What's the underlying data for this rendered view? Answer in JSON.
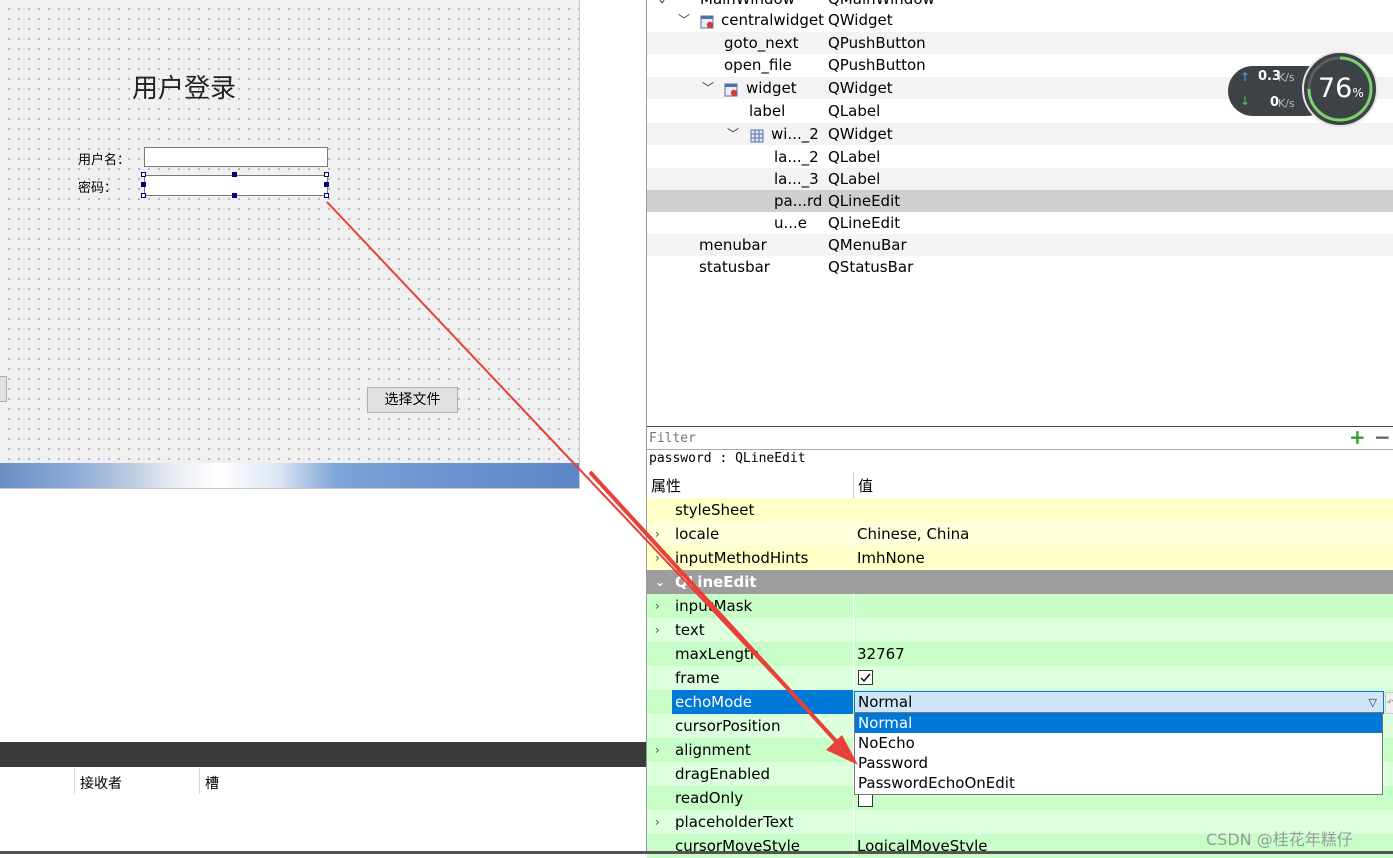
{
  "form": {
    "title": "用户登录",
    "username_label": "用户名：",
    "password_label": "密码：",
    "choose_file_button": "选择文件"
  },
  "bottom_table": {
    "headers": [
      "接收者",
      "槽"
    ]
  },
  "object_tree": {
    "rows": [
      {
        "name": "MainWindow",
        "class": "QMainWindow"
      },
      {
        "name": "centralwidget",
        "class": "QWidget"
      },
      {
        "name": "goto_next",
        "class": "QPushButton"
      },
      {
        "name": "open_file",
        "class": "QPushButton"
      },
      {
        "name": "widget",
        "class": "QWidget"
      },
      {
        "name": "label",
        "class": "QLabel"
      },
      {
        "name": "wi..._2",
        "class": "QWidget"
      },
      {
        "name": "la..._2",
        "class": "QLabel"
      },
      {
        "name": "la..._3",
        "class": "QLabel"
      },
      {
        "name": "pa...rd",
        "class": "QLineEdit"
      },
      {
        "name": "u...e",
        "class": "QLineEdit"
      },
      {
        "name": "menubar",
        "class": "QMenuBar"
      },
      {
        "name": "statusbar",
        "class": "QStatusBar"
      }
    ]
  },
  "speed_widget": {
    "up": "0.3",
    "up_unit": "K/s",
    "down": "0",
    "down_unit": "K/s",
    "percent": "76",
    "percent_unit": "%"
  },
  "property_editor": {
    "filter_placeholder": "Filter",
    "object_label": "password : QLineEdit",
    "header_property": "属性",
    "header_value": "值",
    "rows": [
      {
        "name": "styleSheet",
        "value": ""
      },
      {
        "name": "locale",
        "value": "Chinese, China"
      },
      {
        "name": "inputMethodHints",
        "value": "ImhNone"
      },
      {
        "name": "QLineEdit",
        "value": ""
      },
      {
        "name": "inputMask",
        "value": ""
      },
      {
        "name": "text",
        "value": ""
      },
      {
        "name": "maxLength",
        "value": "32767"
      },
      {
        "name": "frame",
        "value": ""
      },
      {
        "name": "echoMode",
        "value": "Normal"
      },
      {
        "name": "cursorPosition",
        "value": ""
      },
      {
        "name": "alignment",
        "value": ""
      },
      {
        "name": "dragEnabled",
        "value": ""
      },
      {
        "name": "readOnly",
        "value": ""
      },
      {
        "name": "placeholderText",
        "value": ""
      },
      {
        "name": "cursorMoveStyle",
        "value": "LogicalMoveStyle"
      }
    ],
    "echo_options": [
      "Normal",
      "NoEcho",
      "Password",
      "PasswordEchoOnEdit"
    ],
    "frame_checked": true,
    "read_only_checked": false
  },
  "watermark": "CSDN @桂花年糕仔",
  "colors": {
    "selection": "#0078d7",
    "arrow": "#e8403a",
    "property_yellow": "#ffffc8",
    "property_green": "#c8ffc8"
  }
}
